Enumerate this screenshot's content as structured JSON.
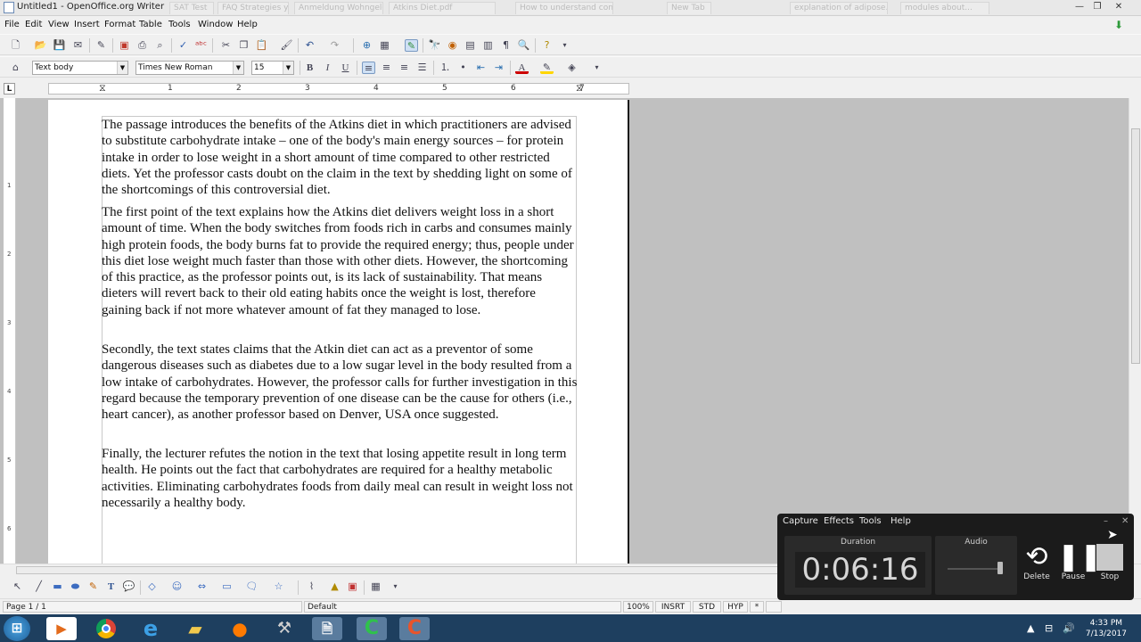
{
  "window": {
    "title": "Untitled1 - OpenOffice.org Writer",
    "background_tabs": [
      "SAT Test",
      "FAQ Strategies year in...",
      "Anmeldung Wohngeld...",
      "Atkins Diet.pdf",
      "How to understand conn...",
      "New Tab",
      "explanation of adipose...",
      "modules about..."
    ],
    "minimize": "—",
    "restore": "❐",
    "close": "✕"
  },
  "menu": [
    "File",
    "Edit",
    "View",
    "Insert",
    "Format",
    "Table",
    "Tools",
    "Window",
    "Help"
  ],
  "formatting": {
    "paragraph_style": "Text body",
    "font_name": "Times New Roman",
    "font_size": "15",
    "bold": "B",
    "italic": "I",
    "underline": "U",
    "text_color_glyph": "A"
  },
  "ruler": {
    "corner": "L",
    "marks": [
      "1",
      "2",
      "3",
      "4",
      "5",
      "6",
      "7"
    ],
    "vertical_marks": [
      "1",
      "2",
      "3",
      "4",
      "5",
      "6"
    ]
  },
  "document": {
    "paragraphs": [
      "The passage introduces the benefits of the Atkins diet in which practitioners are advised to substitute carbohydrate intake – one of the body's main energy sources – for protein intake in order to lose weight in a short amount of time compared to other restricted diets. Yet the professor casts doubt on the claim in the text by shedding light on some of the shortcomings of this controversial diet.",
      "The first point of the text explains how the Atkins diet delivers weight loss in a short amount of time. When the body switches from foods rich in carbs and consumes mainly high protein foods, the body burns fat to provide the required energy; thus, people under this diet lose weight much faster than those with other diets. However, the shortcoming of this practice, as the professor points out, is its lack of sustainability. That means dieters will revert back to their old eating habits once the weight is lost, therefore gaining back if not more whatever amount of fat they managed to lose.",
      "Secondly, the text states claims that the Atkin diet can act as a preventor of some dangerous diseases such as diabetes due to a low sugar level in the body resulted from a low intake of carbohydrates. However, the professor calls for further investigation in this regard because the temporary prevention of one disease can be the cause for others (i.e., heart cancer), as another professor based on Denver, USA once suggested.",
      "Finally, the lecturer refutes the notion in the text that losing appetite result in long term health. He points out the fact that carbohydrates are required for a healthy metabolic activities. Eliminating carbohydrates foods from daily meal can result in weight loss not necessarily a healthy body."
    ]
  },
  "status": {
    "page": "Page 1 / 1",
    "style": "Default",
    "zoom": "100%",
    "insert_mode": "INSRT",
    "selection_mode": "STD",
    "hyphenation": "HYP",
    "modified": "*"
  },
  "recorder": {
    "menu": [
      "Capture",
      "Effects",
      "Tools",
      "Help"
    ],
    "duration_label": "Duration",
    "duration": "0:06:16",
    "audio_label": "Audio",
    "delete_label": "Delete",
    "pause_label": "Pause",
    "stop_label": "Stop"
  },
  "taskbar": {
    "time": "4:33 PM",
    "date": "7/13/2017"
  },
  "colors": {
    "taskbar": "#1e3f5f",
    "recorder": "#1b1b1b",
    "workspace": "#c0c0c0",
    "font_color_bar": "#cc0000",
    "highlight_bar": "#ffd600"
  }
}
